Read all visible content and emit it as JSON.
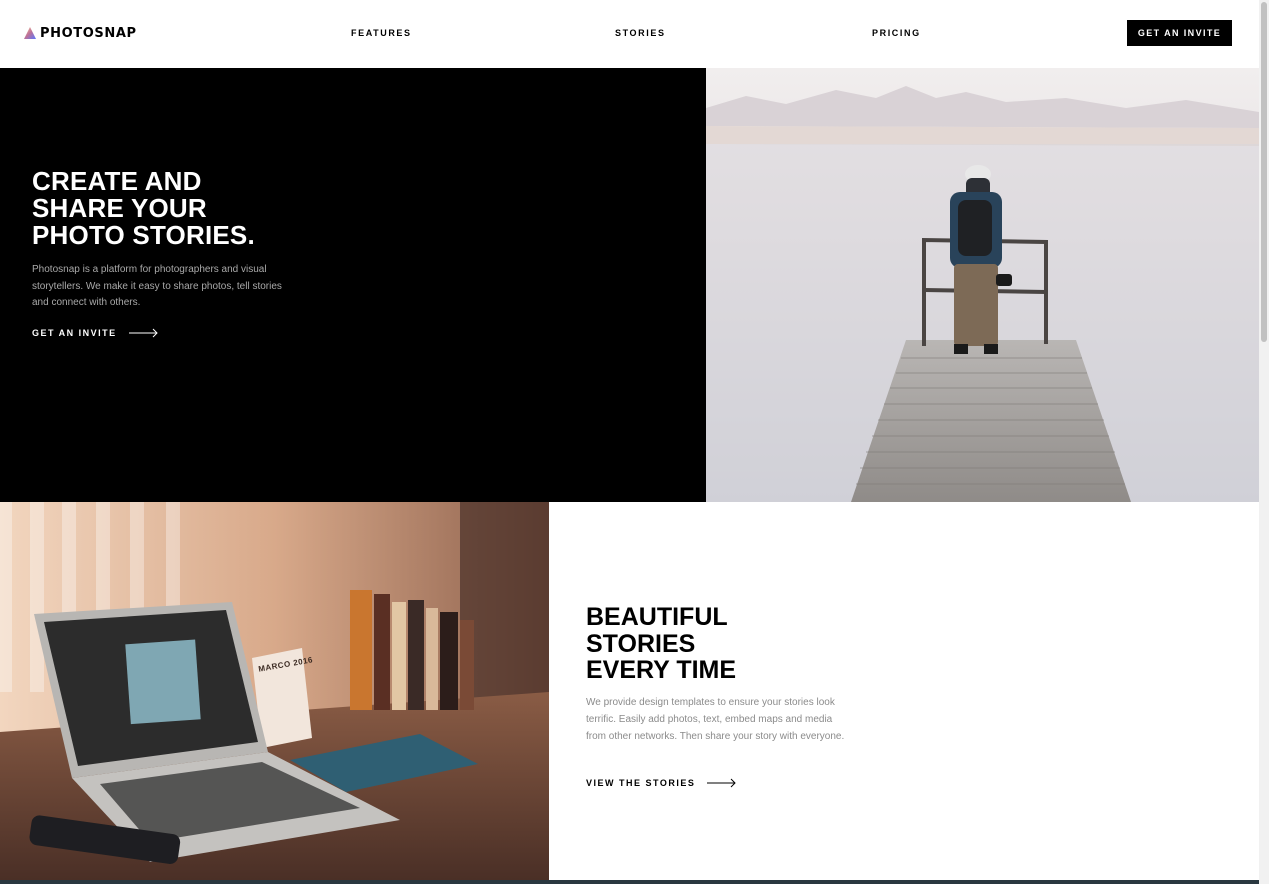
{
  "header": {
    "brand": "PHOTOSNAP",
    "nav": {
      "features": "FEATURES",
      "stories": "STORIES",
      "pricing": "PRICING"
    },
    "cta_label": "GET AN INVITE"
  },
  "hero": {
    "title_lines": [
      "CREATE AND",
      "SHARE YOUR",
      "PHOTO STORIES."
    ],
    "description": "Photosnap is a platform for photographers and visual storytellers. We make it easy to share photos, tell stories and connect with others.",
    "cta_label": "GET AN INVITE"
  },
  "stories_section": {
    "title_lines": [
      "BEAUTIFUL",
      "STORIES",
      "EVERY TIME"
    ],
    "description": "We provide design templates to ensure your stories look terrific. Easily add photos, text, embed maps and media from other networks. Then share your story with everyone.",
    "cta_label": "VIEW THE STORIES"
  },
  "photos": {
    "desk_calendar_month": "MARCO 2016"
  },
  "icons": {
    "logo": "gradient-triangle-icon",
    "arrow": "arrow-right-icon"
  },
  "colors": {
    "hero_bg": "#000000",
    "accent_gradient": [
      "#FFC593",
      "#BC7198",
      "#5A77FF"
    ],
    "body_text_muted": "#8b8b8b"
  }
}
